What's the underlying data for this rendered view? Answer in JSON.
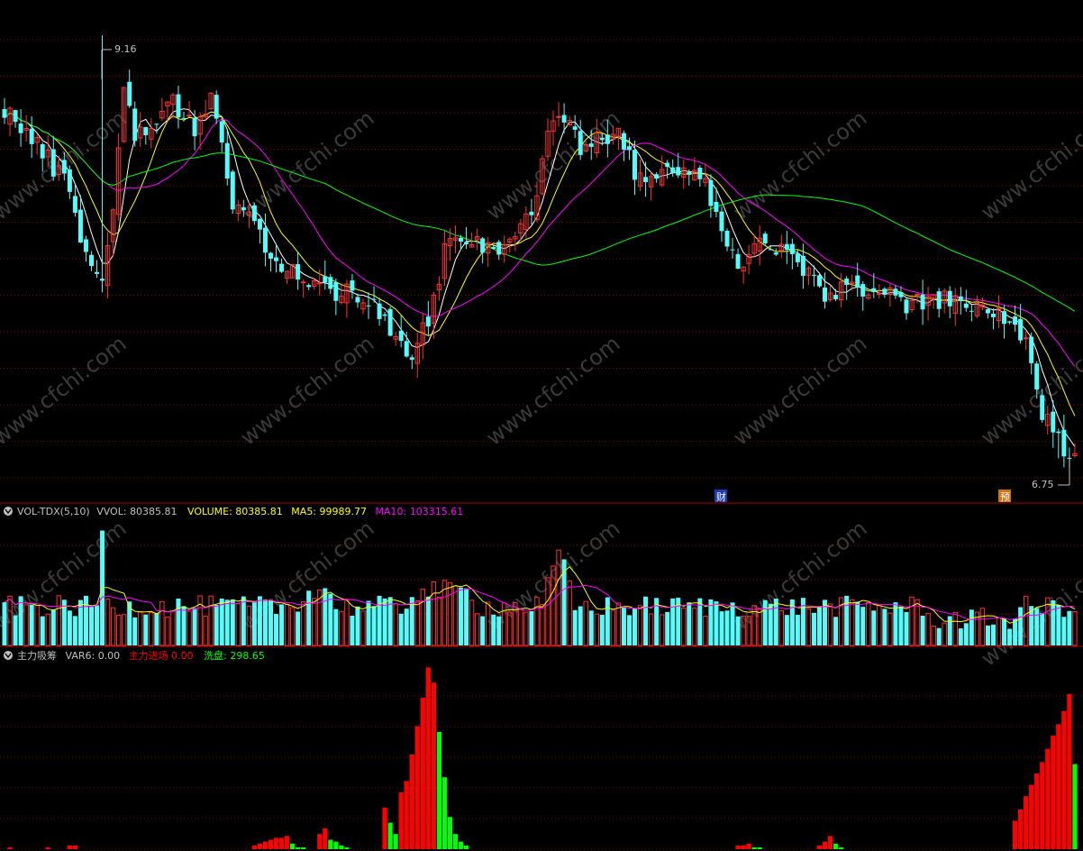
{
  "colors": {
    "background": "#000000",
    "up": "#ff3232",
    "down": "#54fcfc",
    "grid": "#8b0000",
    "frame": "#b00000",
    "ma_short": "#ffffff",
    "ma_mid": "#ffff00",
    "ma_long": "#ff00ff",
    "ma_longest": "#00ff00",
    "text_grey": "#c0c0c0",
    "text_yellow": "#ffff00",
    "text_magenta": "#ff00ff",
    "text_red": "#ff0000",
    "text_green": "#00ff00",
    "zhuli_bar": "#ff0000",
    "xipan_bar": "#00ff00",
    "watermark": "#3a3a3a"
  },
  "price_panel": {
    "high_label": "9.16",
    "low_label": "6.75",
    "event_markers": [
      {
        "text": "财",
        "style": "cai"
      },
      {
        "text": "预",
        "style": "yu"
      }
    ]
  },
  "volume_panel": {
    "indicator_icon": "collapse-circle-icon",
    "name": "VOL-TDX(5,10)",
    "vvol": "VVOL: 80385.81",
    "volume": "VOLUME: 80385.81",
    "ma5": "MA5: 99989.77",
    "ma10": "MA10: 103315.61"
  },
  "indicator_panel": {
    "indicator_icon": "collapse-circle-icon",
    "name": "主力吸筹",
    "var6": "VAR6: 0.00",
    "zhuli": "主力进场  0.00",
    "xipan": "洗盘: 298.65"
  },
  "watermark": "www.cfchi.com",
  "chart_data": {
    "type": "candlestick",
    "price_range": [
      6.65,
      9.32
    ],
    "anchors_close": [
      [
        0,
        8.75
      ],
      [
        8,
        8.45
      ],
      [
        12,
        8.3
      ],
      [
        15,
        7.9
      ],
      [
        18,
        7.75
      ],
      [
        20,
        8.2
      ],
      [
        22,
        8.9
      ],
      [
        24,
        8.55
      ],
      [
        28,
        8.7
      ],
      [
        31,
        8.8
      ],
      [
        35,
        8.6
      ],
      [
        38,
        8.85
      ],
      [
        42,
        8.2
      ],
      [
        46,
        8.1
      ],
      [
        48,
        7.9
      ],
      [
        52,
        7.85
      ],
      [
        56,
        7.75
      ],
      [
        60,
        7.7
      ],
      [
        64,
        7.72
      ],
      [
        68,
        7.62
      ],
      [
        72,
        7.4
      ],
      [
        75,
        7.32
      ],
      [
        78,
        7.55
      ],
      [
        82,
        8.05
      ],
      [
        86,
        8.0
      ],
      [
        90,
        7.95
      ],
      [
        94,
        8.0
      ],
      [
        98,
        8.25
      ],
      [
        100,
        8.6
      ],
      [
        103,
        8.72
      ],
      [
        106,
        8.5
      ],
      [
        109,
        8.55
      ],
      [
        113,
        8.65
      ],
      [
        116,
        8.35
      ],
      [
        120,
        8.35
      ],
      [
        124,
        8.4
      ],
      [
        128,
        8.35
      ],
      [
        131,
        8.18
      ],
      [
        135,
        7.82
      ],
      [
        138,
        7.98
      ],
      [
        142,
        7.93
      ],
      [
        146,
        7.9
      ],
      [
        150,
        7.68
      ],
      [
        154,
        7.72
      ],
      [
        158,
        7.73
      ],
      [
        162,
        7.68
      ],
      [
        166,
        7.63
      ],
      [
        170,
        7.63
      ],
      [
        174,
        7.65
      ],
      [
        178,
        7.6
      ],
      [
        182,
        7.6
      ],
      [
        185,
        7.52
      ],
      [
        188,
        7.38
      ],
      [
        191,
        7.0
      ],
      [
        194,
        6.84
      ],
      [
        196,
        6.8
      ]
    ],
    "low_anchor": {
      "index": 194,
      "value": 6.75
    },
    "high_anchor": {
      "index": 18,
      "value": 9.16
    },
    "moving_averages": [
      {
        "name": "MA5",
        "period": 5
      },
      {
        "name": "MA10",
        "period": 10
      },
      {
        "name": "MA20",
        "period": 20
      },
      {
        "name": "MA60",
        "period": 60
      }
    ],
    "volume": {
      "latest": 80385.81,
      "ma5": 99989.77,
      "ma10": 103315.61
    },
    "zhuli_xichou": {
      "var6": 0.0,
      "zhuli_jinchang": 0.0,
      "xipan": 298.65,
      "red_bars": [
        [
          1,
          0.01
        ],
        [
          8,
          0.01
        ],
        [
          12,
          0.02
        ],
        [
          13,
          0.02
        ],
        [
          46,
          0.02
        ],
        [
          47,
          0.03
        ],
        [
          48,
          0.04
        ],
        [
          49,
          0.05
        ],
        [
          50,
          0.06
        ],
        [
          51,
          0.06
        ],
        [
          52,
          0.07
        ],
        [
          58,
          0.08
        ],
        [
          59,
          0.11
        ],
        [
          70,
          0.22
        ],
        [
          73,
          0.3
        ],
        [
          74,
          0.36
        ],
        [
          75,
          0.5
        ],
        [
          76,
          0.65
        ],
        [
          77,
          0.8
        ],
        [
          78,
          0.96
        ],
        [
          79,
          0.88
        ],
        [
          135,
          0.02
        ],
        [
          136,
          0.02
        ],
        [
          137,
          0.03
        ],
        [
          150,
          0.02
        ],
        [
          151,
          0.04
        ],
        [
          152,
          0.07
        ],
        [
          186,
          0.15
        ],
        [
          187,
          0.21
        ],
        [
          188,
          0.28
        ],
        [
          189,
          0.34
        ],
        [
          190,
          0.4
        ],
        [
          191,
          0.46
        ],
        [
          192,
          0.53
        ],
        [
          193,
          0.6
        ],
        [
          194,
          0.66
        ],
        [
          195,
          0.73
        ],
        [
          196,
          0.82
        ]
      ],
      "green_bars": [
        [
          53,
          0.03
        ],
        [
          54,
          0.01
        ],
        [
          55,
          0.01
        ],
        [
          60,
          0.05
        ],
        [
          61,
          0.04
        ],
        [
          62,
          0.02
        ],
        [
          63,
          0.01
        ],
        [
          71,
          0.14
        ],
        [
          72,
          0.08
        ],
        [
          80,
          0.62
        ],
        [
          81,
          0.38
        ],
        [
          82,
          0.17
        ],
        [
          83,
          0.08
        ],
        [
          84,
          0.04
        ],
        [
          85,
          0.02
        ],
        [
          138,
          0.01
        ],
        [
          139,
          0.01
        ],
        [
          153,
          0.03
        ],
        [
          154,
          0.01
        ],
        [
          197,
          0.45
        ]
      ]
    }
  }
}
